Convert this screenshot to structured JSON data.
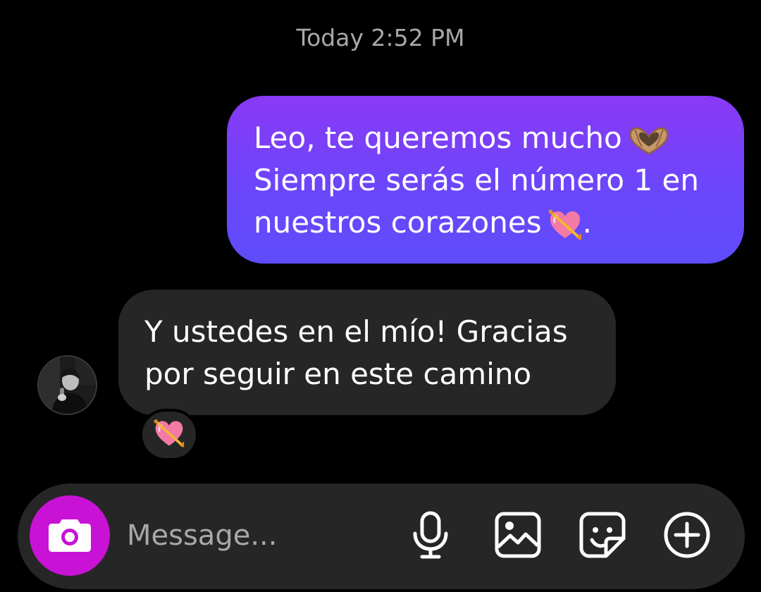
{
  "timestamp": "Today 2:52 PM",
  "outgoing_message": {
    "lines": [
      "Leo, te queremos mucho",
      "Siempre serás el número 1 en",
      "nuestros corazones"
    ],
    "line3_suffix": ".",
    "emojis": [
      "heart-hands-emoji",
      "heart-with-arrow-emoji"
    ]
  },
  "incoming_message": {
    "lines": [
      "Y ustedes en el mío! Gracias",
      "por seguir en este camino"
    ],
    "reaction": "heart-with-arrow-emoji"
  },
  "composer": {
    "placeholder": "Message...",
    "icons": [
      "camera-icon",
      "microphone-icon",
      "gallery-icon",
      "sticker-icon",
      "plus-circle-icon"
    ]
  },
  "colors": {
    "outgoing_bubble_top": "#8a39f5",
    "outgoing_bubble_bottom": "#5f4cfb",
    "incoming_bubble": "#262626",
    "camera_button": "#c812d6",
    "timestamp_text": "#a8a8a8",
    "background": "#000000"
  }
}
